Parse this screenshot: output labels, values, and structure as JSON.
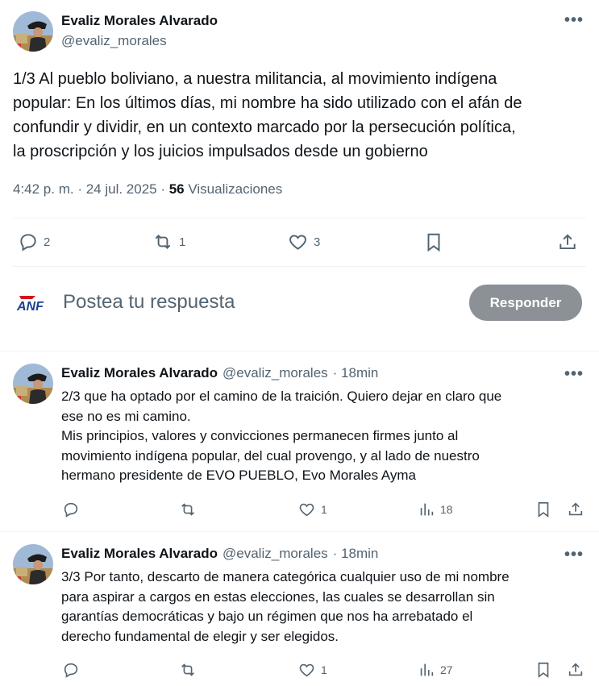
{
  "main_tweet": {
    "author_name": "Evaliz Morales Alvarado",
    "handle": "@evaliz_morales",
    "text_lines": [
      "1/3 Al pueblo boliviano, a nuestra militancia, al movimiento indígena",
      "popular: En los últimos días, mi nombre ha sido utilizado con el afán de",
      "confundir y dividir, en un contexto marcado por la persecución política,",
      "la proscripción y los juicios impulsados desde un gobierno"
    ],
    "timestamp": "4:42 p. m. · 24 jul. 2025 · ",
    "views_count": "56",
    "views_label": " Visualizaciones",
    "replies": "2",
    "reposts": "1",
    "likes": "3"
  },
  "composer": {
    "logo_text": "ANF",
    "placeholder": "Postea tu respuesta",
    "button_label": "Responder"
  },
  "replies": [
    {
      "author_name": "Evaliz Morales Alvarado",
      "handle": "@evaliz_morales",
      "time": "· 18min",
      "text_lines": [
        "2/3 que ha optado por el camino de la traición. Quiero dejar en claro que",
        "ese no es mi camino.",
        "Mis principios, valores y convicciones permanecen firmes junto al",
        "movimiento indígena popular, del cual provengo, y al lado de nuestro",
        "hermano presidente de EVO PUEBLO, Evo Morales Ayma"
      ],
      "likes": "1",
      "views": "18"
    },
    {
      "author_name": "Evaliz Morales Alvarado",
      "handle": "@evaliz_morales",
      "time": "· 18min",
      "text_lines": [
        "3/3 Por tanto, descarto de manera categórica cualquier uso de mi nombre",
        "para aspirar a cargos en estas elecciones, las cuales se desarrollan sin",
        "garantías democráticas y bajo un régimen que nos ha arrebatado el",
        "derecho fundamental de elegir y ser elegidos."
      ],
      "likes": "1",
      "views": "27"
    }
  ],
  "colors": {
    "text": "#0f1419",
    "muted": "#536471",
    "divider": "#eff3f4",
    "button_disabled": "#8b9196",
    "anf_blue": "#1d3f8f",
    "anf_red": "#d4141c"
  },
  "icons": [
    "reply-icon",
    "repost-icon",
    "like-icon",
    "bookmark-icon",
    "share-icon",
    "views-icon",
    "more-icon"
  ]
}
